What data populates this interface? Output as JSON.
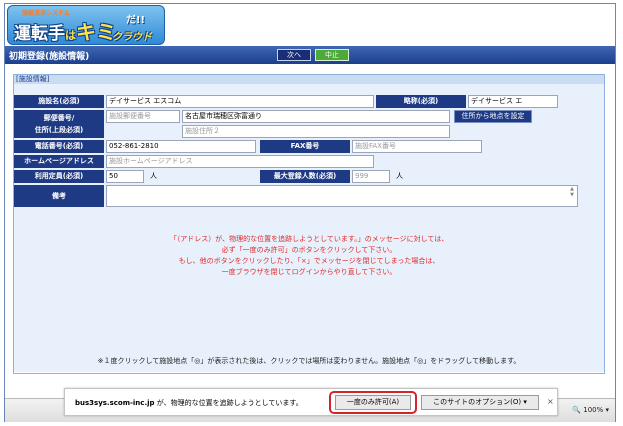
{
  "logo": {
    "small": "施設送迎システム",
    "main": "運転手",
    "ha": "は",
    "kimi": "キミ",
    "da": "だ!!",
    "cloud": "クラウド"
  },
  "title_bar": {
    "title": "初期登録(施設情報)",
    "next": "次へ",
    "stop": "中止"
  },
  "section": {
    "title": "[施設情報]"
  },
  "form": {
    "facility_name_label": "施設名(必須)",
    "facility_name_value": "デイサービス エスコム",
    "abbr_label": "略称(必須)",
    "abbr_value": "デイサービス エ",
    "postal_label": "郵便番号/\n住所(上段必須)",
    "postal_placeholder": "施設郵便番号",
    "address1_value": "名古屋市瑞穂区弥富通り",
    "address2_placeholder": "施設住所２",
    "geo_button": "住所から地点を設定",
    "phone_label": "電話番号(必須)",
    "phone_value": "052-861-2810",
    "fax_label": "FAX番号",
    "fax_placeholder": "施設FAX番号",
    "homepage_label": "ホームページアドレス",
    "homepage_placeholder": "施設ホームページアドレス",
    "capacity_label": "利用定員(必須)",
    "capacity_value": "50",
    "capacity_unit": "人",
    "max_reg_label": "最大登録人数(必須)",
    "max_reg_value": "999",
    "max_reg_unit": "人",
    "notes_label": "備考"
  },
  "warning": [
    "「（アドレス）が、物理的な位置を追跡しようとしています。」のメッセージに対しては、",
    "必ず「一度のみ許可」のボタンをクリックして下さい。",
    "もし、他のボタンをクリックしたり、「×」でメッセージを閉じてしまった場合は、",
    "一度ブラウザを閉じてログインからやり直して下さい。"
  ],
  "footnote": "※１度クリックして施設地点「◎」が表示された後は、クリックでは場所は変わりません。施設地点「◎」をドラッグして移動します。",
  "notification": {
    "host": "bus3sys.scom-inc.jp",
    "message": " が、物理的な位置を追跡しようとしています。",
    "allow_once": "一度のみ許可(A)",
    "options": "このサイトのオプション(O) ▾",
    "close": "×"
  },
  "zoom": "🔍 100% ▾",
  "colors": {
    "header_blue": "#1f3a84",
    "panel_bg": "#e7f0fb",
    "warn_red": "#e02a2a",
    "stop_green": "#4daa3a",
    "ring_red": "#d4262a"
  }
}
